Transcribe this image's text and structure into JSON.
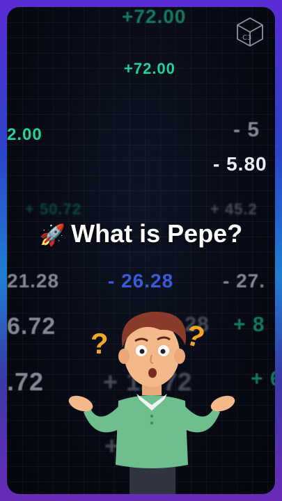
{
  "title": {
    "emoji": "🚀",
    "text": "What is Pepe?"
  },
  "tickers": [
    "+72.00",
    "+72.00",
    "2.00",
    "- 5",
    "- 5.80",
    "+ 50.72",
    "+ 45.2",
    "21.28",
    "- 26.28",
    "- 27.",
    "6.72",
    "+ 8",
    "- 6.28",
    ".72",
    "+ 12.72",
    "+ 6",
    "+ 6.72"
  ],
  "icons": {
    "logo": "cube-logo-icon",
    "person": "confused-person-illustration"
  },
  "colors": {
    "green": "#1fd39a",
    "blue": "#3a5bd8",
    "border_top": "#5b2bd6",
    "border_mid": "#1f7fd2"
  }
}
